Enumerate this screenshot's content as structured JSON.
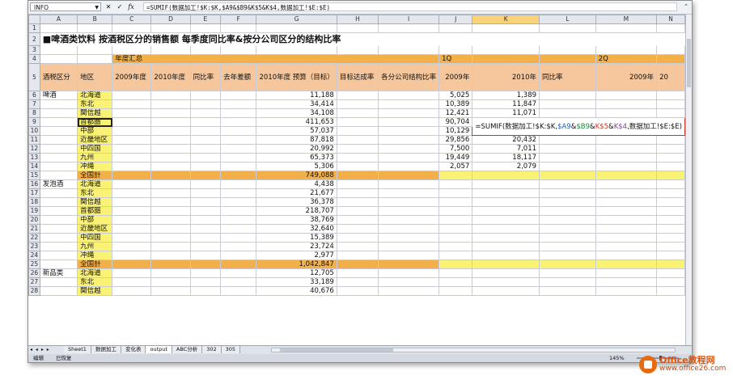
{
  "formula_bar": {
    "name_box": "INFO",
    "cancel_icon": "✕",
    "enter_icon": "✓",
    "fx_label": "fx",
    "formula": "=SUMIF(数据加工!$K:$K,$A9&$B9&K$5&K$4,数据加工!$E:$E)"
  },
  "columns": [
    "A",
    "B",
    "C",
    "D",
    "E",
    "F",
    "G",
    "H",
    "I",
    "J",
    "K",
    "L",
    "M",
    "N"
  ],
  "selected_column": "K",
  "title": "■啤酒类饮料 按酒税区分的销售额 每季度同比率&按分公司区分的结构比率",
  "row4": {
    "annual_summary": "年度汇总",
    "q1": "1Q",
    "q2": "2Q"
  },
  "headers": {
    "category": "酒税区分",
    "region": "地区",
    "y2009": "2009年度",
    "y2010": "2010年度",
    "yoy": "同比率",
    "last_year_diff": "去年差额",
    "budget": "2010年度 预算（目标）",
    "achievement": "目标达成率",
    "branch_ratio": "各分公司结构比率",
    "q2009": "2009年",
    "q2010": "2010年",
    "q_yoy": "同比率",
    "q2_2009": "2009年",
    "q2_next": "20"
  },
  "row_numbers": [
    "1",
    "2",
    "3",
    "4",
    "5",
    "6",
    "7",
    "8",
    "9",
    "10",
    "11",
    "12",
    "13",
    "14",
    "15",
    "16",
    "17",
    "18",
    "19",
    "20",
    "21",
    "22",
    "23",
    "24",
    "25",
    "26",
    "27",
    "28"
  ],
  "groups": [
    {
      "category": "啤酒",
      "rows": [
        {
          "region": "北海道",
          "budget": "11,188",
          "q2009": "5,025",
          "q2010": "1,389"
        },
        {
          "region": "东北",
          "budget": "34,414",
          "q2009": "10,389",
          "q2010": "11,847"
        },
        {
          "region": "関信越",
          "budget": "34,108",
          "q2009": "12,421",
          "q2010": "11,071"
        },
        {
          "region": "首都圏",
          "budget": "411,653",
          "q2009": "90,704",
          "q2010": ""
        },
        {
          "region": "中部",
          "budget": "57,037",
          "q2009": "10,129",
          "q2010": ""
        },
        {
          "region": "近畿地区",
          "budget": "87,818",
          "q2009": "29,856",
          "q2010": "20,432"
        },
        {
          "region": "中四国",
          "budget": "20,992",
          "q2009": "7,500",
          "q2010": "7,011"
        },
        {
          "region": "九州",
          "budget": "65,373",
          "q2009": "19,449",
          "q2010": "18,117"
        },
        {
          "region": "冲绳",
          "budget": "5,306",
          "q2009": "2,057",
          "q2010": "2,079"
        }
      ],
      "total": {
        "region": "全国計",
        "budget": "749,088"
      }
    },
    {
      "category": "发泡酒",
      "rows": [
        {
          "region": "北海道",
          "budget": "4,438"
        },
        {
          "region": "东北",
          "budget": "21,677"
        },
        {
          "region": "関信越",
          "budget": "36,378"
        },
        {
          "region": "首都圏",
          "budget": "218,707"
        },
        {
          "region": "中部",
          "budget": "38,769"
        },
        {
          "region": "近畿地区",
          "budget": "32,640"
        },
        {
          "region": "中四国",
          "budget": "15,389"
        },
        {
          "region": "九州",
          "budget": "23,724"
        },
        {
          "region": "冲绳",
          "budget": "2,977"
        }
      ],
      "total": {
        "region": "全国計",
        "budget": "1,042,847"
      }
    },
    {
      "category": "新品类",
      "rows": [
        {
          "region": "北海道",
          "budget": "12,705"
        },
        {
          "region": "东北",
          "budget": "33,189"
        },
        {
          "region": "関信越",
          "budget": "40,676"
        }
      ]
    }
  ],
  "formula_cell": {
    "part1_black": "=SUMIF(数据加工!$K:$K,",
    "part1_blue": "$A9",
    "part1_amp": "&",
    "part1_green": "$B9",
    "part1_amp2": "&",
    "part2_red": "K$5",
    "part2_amp": "&",
    "part2_purple": "K$4",
    "part2_rest": ",数据加工!$E:$E)"
  },
  "sheet_tabs": [
    "Sheet1",
    "数据加工",
    "变化表",
    "output",
    "ABC分析",
    "302",
    "305"
  ],
  "tab_nav": "◂ ◂ ▸ ▸",
  "status": {
    "mode": "编辑",
    "recovered": "已恢复",
    "zoom": "145%"
  },
  "logo": {
    "name": "Office教程网",
    "url": "www.office26.com"
  },
  "colors": {
    "orange": "#f2b04b",
    "peach": "#f6c79c",
    "yellow": "#faf276",
    "formula_border": "#c0392b"
  }
}
